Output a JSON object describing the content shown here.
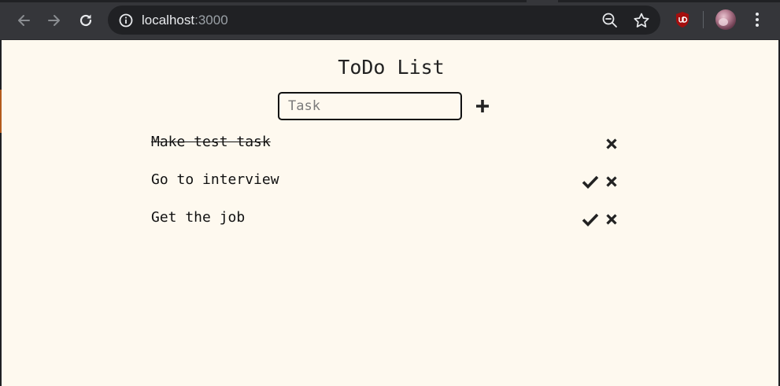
{
  "browser": {
    "url_host": "localhost",
    "url_port": ":3000",
    "icons": {
      "back": "back-arrow-icon",
      "forward": "forward-arrow-icon",
      "reload": "reload-icon",
      "site_info": "info-icon",
      "zoom": "zoom-out-icon",
      "bookmark": "star-icon",
      "extension": "ublock-icon",
      "profile": "avatar",
      "menu": "kebab-menu-icon"
    },
    "colors": {
      "toolbar": "#35363a",
      "omnibox": "#202124",
      "extension": "#a40e0e"
    }
  },
  "app": {
    "title": "ToDo List",
    "input": {
      "value": "",
      "placeholder": "Task"
    },
    "add_icon": "plus-icon",
    "todos": [
      {
        "text": "Make test task",
        "completed": true
      },
      {
        "text": "Go to interview",
        "completed": false
      },
      {
        "text": "Get the job",
        "completed": false
      }
    ],
    "colors": {
      "background": "#fef9ef",
      "text": "#111111"
    }
  }
}
